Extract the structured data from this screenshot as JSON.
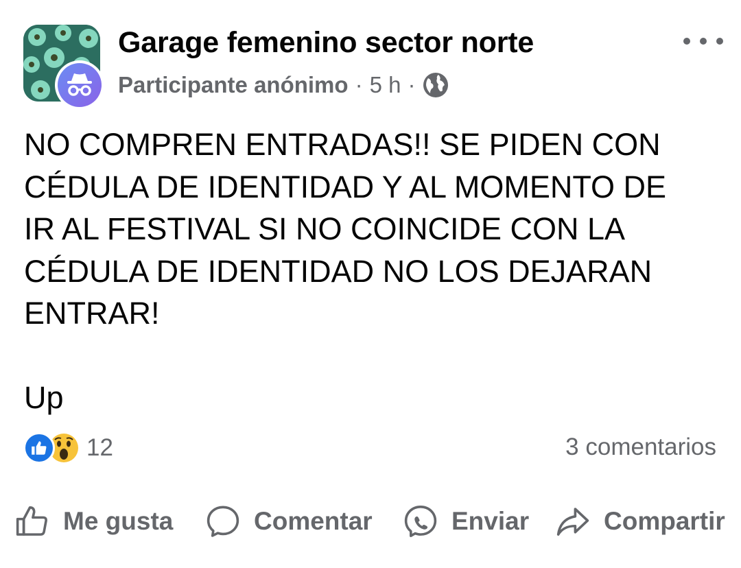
{
  "post": {
    "group_name": "Garage femenino sector norte",
    "author": "Participante anónimo",
    "separator": "·",
    "time": "5 h",
    "body": "NO COMPREN ENTRADAS!! SE PIDEN CON\nCÉDULA DE IDENTIDAD Y AL MOMENTO DE\nIR AL FESTIVAL SI NO COINCIDE CON LA\nCÉDULA DE IDENTIDAD NO LOS DEJARAN\nENTRAR!\n\nUp",
    "privacy_icon": "globe-icon",
    "more_icon": "more-options-icon"
  },
  "stats": {
    "reaction_icons": [
      "like-reaction-icon",
      "wow-reaction-icon"
    ],
    "reactions_count": "12",
    "comments": "3 comentarios"
  },
  "actions": [
    {
      "label": "Me gusta",
      "icon": "thumbs-up-icon"
    },
    {
      "label": "Comentar",
      "icon": "comment-icon"
    },
    {
      "label": "Enviar",
      "icon": "messenger-icon"
    },
    {
      "label": "Compartir",
      "icon": "share-icon"
    }
  ],
  "colors": {
    "text_primary": "#050505",
    "text_secondary": "#65676b",
    "like_blue": "#1b74e4",
    "anon_avatar_start": "#6b8cf3",
    "anon_avatar_end": "#8a63e8"
  }
}
